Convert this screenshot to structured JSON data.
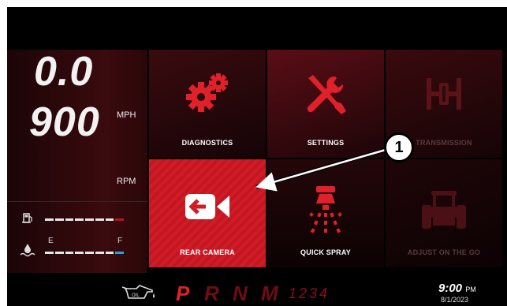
{
  "dash": {
    "speed": "0.0",
    "speed_unit": "MPH",
    "rpm": "900",
    "rpm_unit": "RPM",
    "fuel_empty_label": "E",
    "fuel_full_label": "F"
  },
  "tiles": {
    "diagnostics": "DIAGNOSTICS",
    "settings": "SETTINGS",
    "transmission": "TRANSMISSION",
    "rear_camera": "REAR CAMERA",
    "quick_spray": "QUICK SPRAY",
    "adjust": "ADJUST ON THE GO"
  },
  "gears": {
    "p": "P",
    "r": "R",
    "n": "N",
    "m": "M",
    "numbers": "1234"
  },
  "clock": {
    "time": "9:00",
    "ampm": "PM",
    "date": "8/1/2023"
  },
  "callout": "1",
  "colors": {
    "accent_red": "#d11c27",
    "fuel_blue": "#27a0e6",
    "dark_red": "#3a0a0e"
  },
  "icons": [
    "fuel-icon",
    "coolant-icon",
    "gears-icon",
    "wrench-screwdriver-icon",
    "transmission-icon",
    "camera-icon",
    "sprayer-icon",
    "tractor-icon",
    "oil-icon"
  ]
}
